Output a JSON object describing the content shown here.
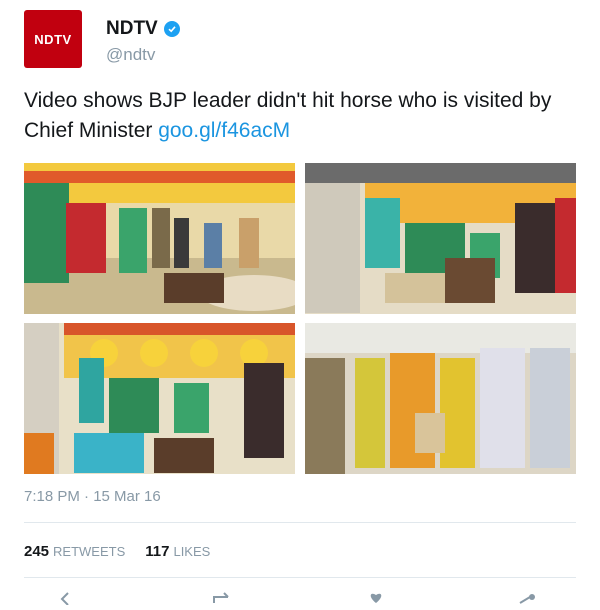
{
  "user": {
    "avatar_text": "NDTV",
    "display_name": "NDTV",
    "handle": "@ndtv",
    "verified_icon": "verified-badge-icon"
  },
  "tweet": {
    "text": "Video shows BJP leader didn't hit horse who is visited by Chief Minister ",
    "link": "goo.gl/f46acM",
    "timestamp": "7:18 PM · 15 Mar 16"
  },
  "media": {
    "photo_count": 4
  },
  "stats": {
    "retweets_count": "245",
    "retweets_label": "RETWEETS",
    "likes_count": "117",
    "likes_label": "LIKES"
  },
  "actions": [
    "reply-icon",
    "retweet-icon",
    "like-icon",
    "share-icon"
  ],
  "colors": {
    "brand": "#c1000f",
    "link": "#1b95e0",
    "muted": "#8899a6",
    "divider": "#e1e8ed"
  }
}
